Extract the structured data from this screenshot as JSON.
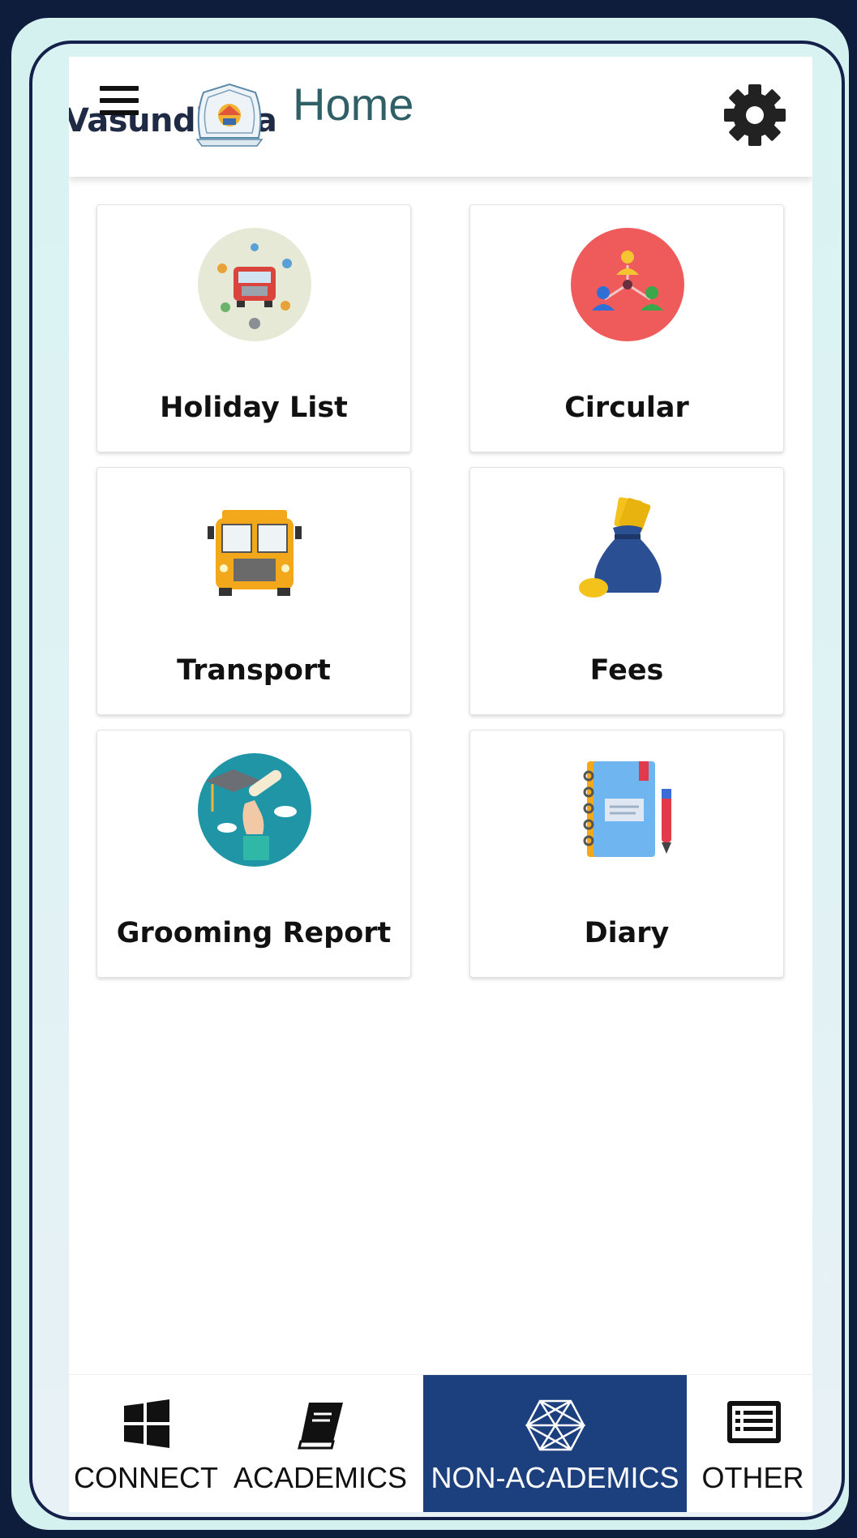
{
  "header": {
    "brand_text": "Vasundhara",
    "title": "Home",
    "menu_icon": "hamburger-menu-icon",
    "settings_icon": "gear-icon"
  },
  "tiles": [
    {
      "label": "Holiday List",
      "icon": "school-bus-collage-icon"
    },
    {
      "label": "Circular",
      "icon": "people-network-icon"
    },
    {
      "label": "Transport",
      "icon": "school-bus-icon"
    },
    {
      "label": "Fees",
      "icon": "money-bag-icon"
    },
    {
      "label": "Grooming Report",
      "icon": "graduation-hand-icon"
    },
    {
      "label": "Diary",
      "icon": "notebook-pen-icon"
    }
  ],
  "bottom_nav": [
    {
      "label": "CONNECT",
      "icon": "windows-icon",
      "active": false
    },
    {
      "label": "ACADEMICS",
      "icon": "book-icon",
      "active": false
    },
    {
      "label": "NON-ACADEMICS",
      "icon": "hexagon-mesh-icon",
      "active": true
    },
    {
      "label": "OTHER",
      "icon": "list-card-icon",
      "active": false
    }
  ],
  "colors": {
    "title": "#2f5f67",
    "nav_active_bg": "#1c3f7e",
    "frame": "#0f1d3d",
    "frame_bg": "#d4f0ef"
  }
}
